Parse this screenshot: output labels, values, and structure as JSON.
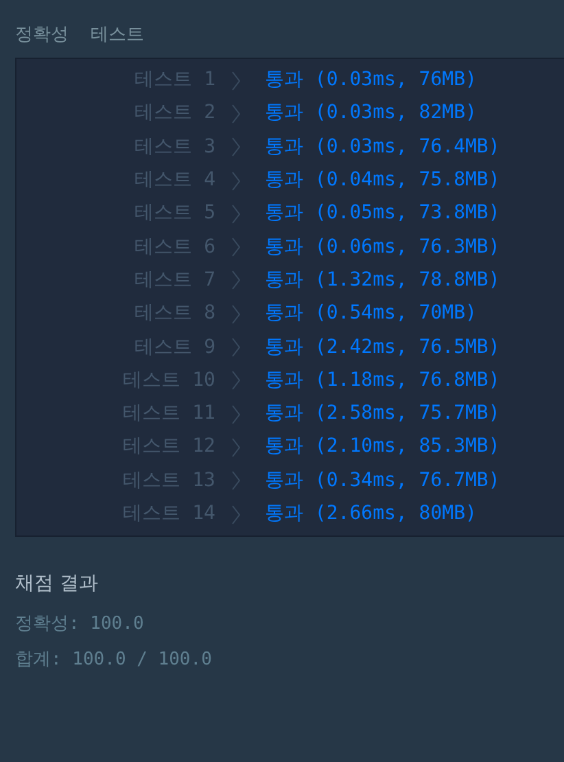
{
  "header": {
    "label": "정확성",
    "title": "테스트"
  },
  "tests": [
    {
      "label": "테스트 1",
      "result": "통과 (0.03ms, 76MB)"
    },
    {
      "label": "테스트 2",
      "result": "통과 (0.03ms, 82MB)"
    },
    {
      "label": "테스트 3",
      "result": "통과 (0.03ms, 76.4MB)"
    },
    {
      "label": "테스트 4",
      "result": "통과 (0.04ms, 75.8MB)"
    },
    {
      "label": "테스트 5",
      "result": "통과 (0.05ms, 73.8MB)"
    },
    {
      "label": "테스트 6",
      "result": "통과 (0.06ms, 76.3MB)"
    },
    {
      "label": "테스트 7",
      "result": "통과 (1.32ms, 78.8MB)"
    },
    {
      "label": "테스트 8",
      "result": "통과 (0.54ms, 70MB)"
    },
    {
      "label": "테스트 9",
      "result": "통과 (2.42ms, 76.5MB)"
    },
    {
      "label": "테스트 10",
      "result": "통과 (1.18ms, 76.8MB)"
    },
    {
      "label": "테스트 11",
      "result": "통과 (2.58ms, 75.7MB)"
    },
    {
      "label": "테스트 12",
      "result": "통과 (2.10ms, 85.3MB)"
    },
    {
      "label": "테스트 13",
      "result": "통과 (0.34ms, 76.7MB)"
    },
    {
      "label": "테스트 14",
      "result": "통과 (2.66ms, 80MB)"
    }
  ],
  "summary": {
    "title": "채점 결과",
    "lines": [
      "정확성: 100.0",
      "합계: 100.0 / 100.0"
    ]
  }
}
